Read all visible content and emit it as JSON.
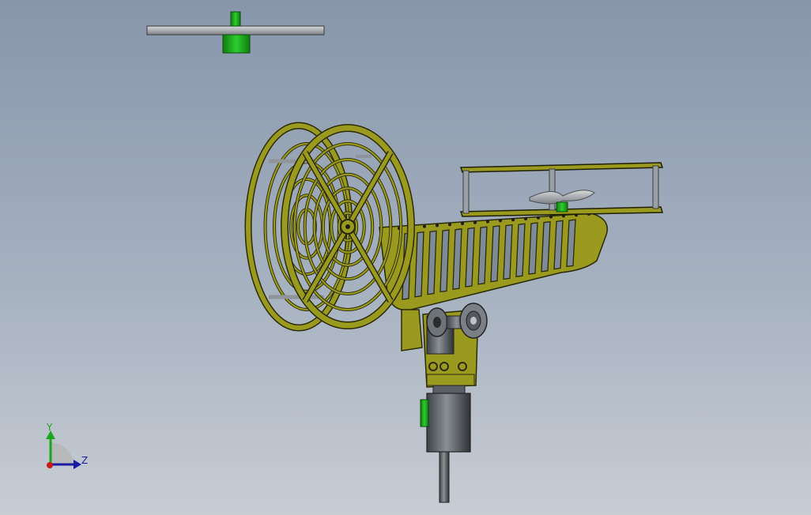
{
  "view": {
    "background_top": "#8796ab",
    "background_bottom": "#c8cdd4"
  },
  "model": {
    "frame_color": "#9a9a1e",
    "frame_edge_color": "#2a2a06",
    "steel_color": "#6e7378",
    "rotor_hub_color": "#19a019",
    "rotor_blade_color": "#b8bcc0"
  },
  "triad": {
    "y_label": "Y",
    "z_label": "Z",
    "y_color": "#1aa51a",
    "z_color": "#1a1aa5",
    "x_color": "#c81a1a",
    "icon": "coordinate-triad-icon"
  }
}
